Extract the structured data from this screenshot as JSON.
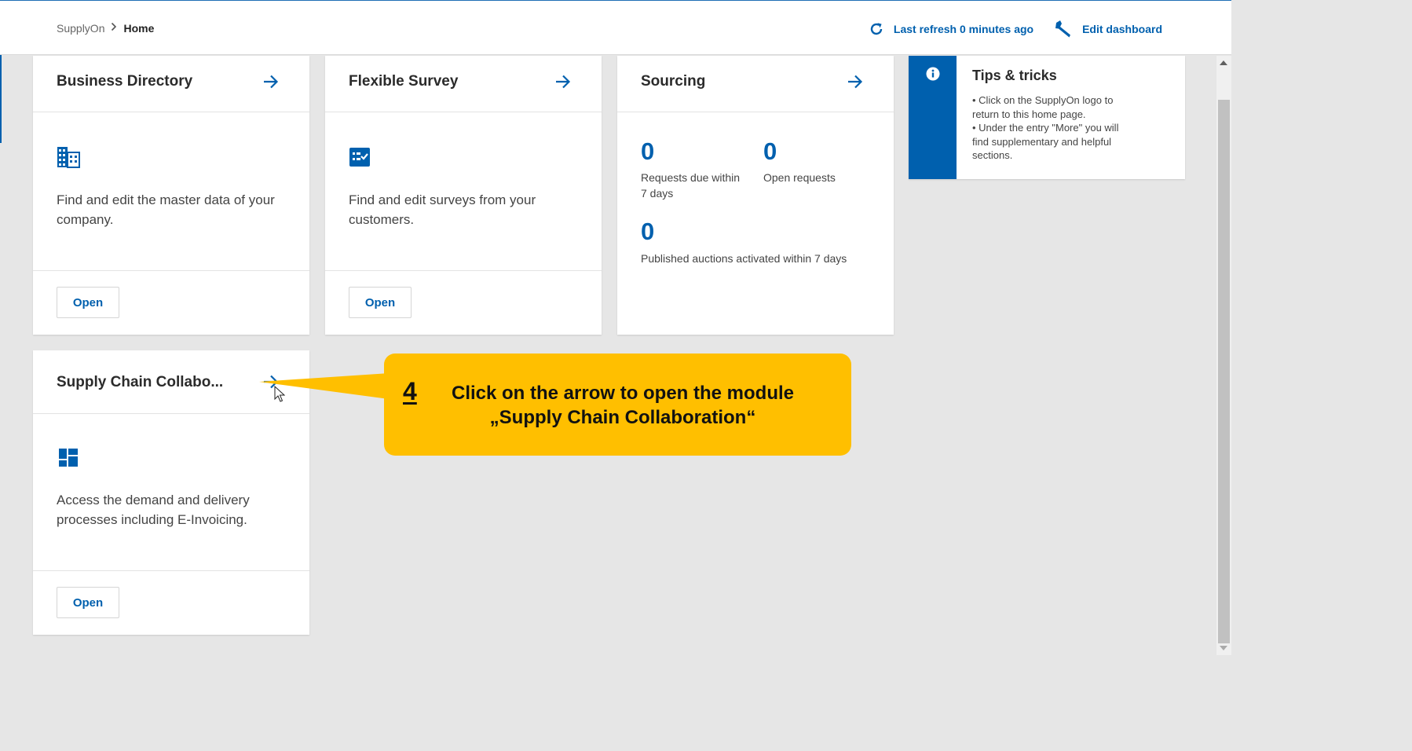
{
  "header": {
    "breadcrumb_root": "SupplyOn",
    "breadcrumb_separator": ">",
    "breadcrumb_current": "Home",
    "refresh_label": "Last refresh 0 minutes ago",
    "edit_label": "Edit dashboard",
    "refresh_icon": "refresh-icon",
    "edit_icon": "wrench-icon"
  },
  "cards": {
    "business_directory": {
      "title": "Business Directory",
      "description": "Find and edit the master data of your company.",
      "open_label": "Open",
      "icon": "building-icon"
    },
    "flexible_survey": {
      "title": "Flexible Survey",
      "description": "Find and edit surveys from your customers.",
      "open_label": "Open",
      "icon": "survey-icon"
    },
    "sourcing": {
      "title": "Sourcing",
      "requests_due_value": "0",
      "requests_due_label": "Requests due within 7 days",
      "open_requests_value": "0",
      "open_requests_label": "Open requests",
      "auctions_value": "0",
      "auctions_label": "Published auctions activated within 7 days"
    },
    "supply_chain": {
      "title": "Supply Chain Collabo...",
      "description": "Access the demand and delivery processes including E-Invoicing.",
      "open_label": "Open",
      "icon": "dashboard-icon"
    }
  },
  "tips": {
    "title": "Tips & tricks",
    "icon": "info-icon",
    "lines": [
      "• Click on the SupplyOn logo to",
      "return to this home page.",
      "• Under the entry \"More\" you will",
      "find supplementary and helpful",
      "sections."
    ]
  },
  "callout": {
    "step": "4",
    "line1": "Click on the arrow to open the module",
    "line2": "„Supply Chain Collaboration“"
  },
  "colors": {
    "brand_blue": "#0060ae",
    "callout_yellow": "#ffbf00",
    "background": "#e6e6e6"
  }
}
